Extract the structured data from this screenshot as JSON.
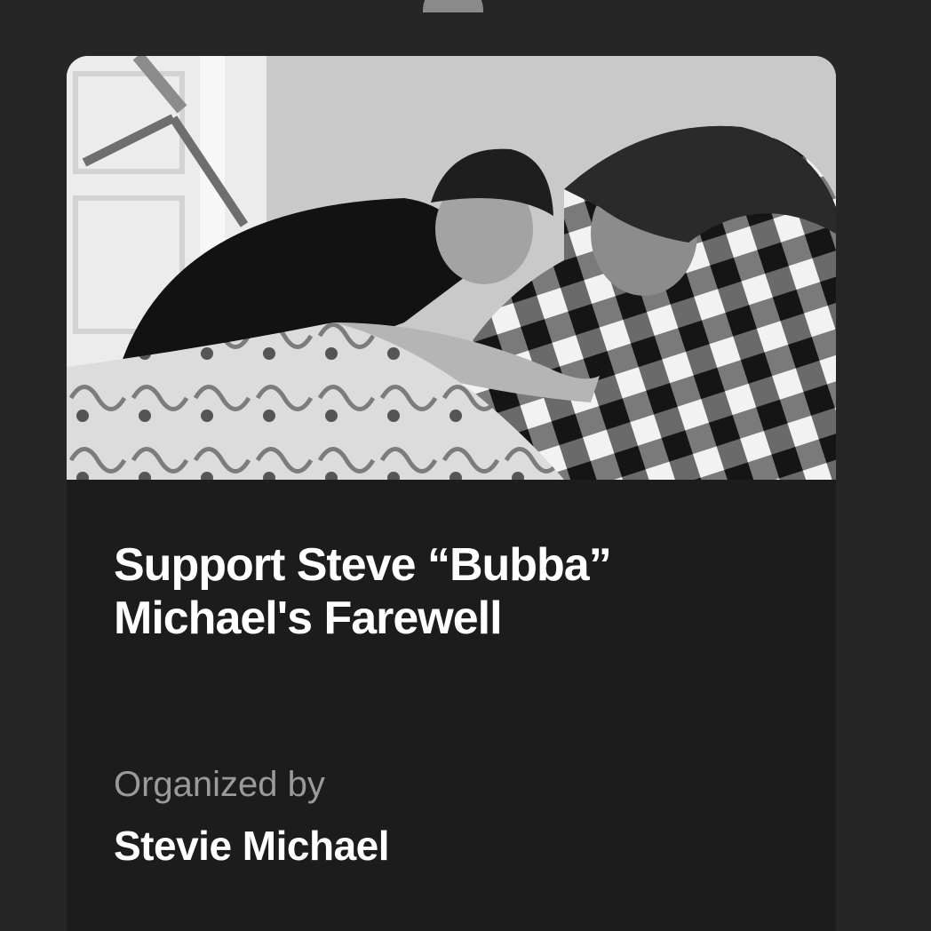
{
  "campaign": {
    "title": "Support Steve “Bubba” Michael's Farewell",
    "organized_by_label": "Organized by",
    "organizer_name": "Stevie Michael"
  },
  "photo": {
    "description_icon": "photo-image",
    "style": "black-and-white"
  },
  "colors": {
    "page_background": "#262626",
    "card_background": "#1c1c1c",
    "title_text": "#ffffff",
    "label_text": "#9a9a9a"
  }
}
